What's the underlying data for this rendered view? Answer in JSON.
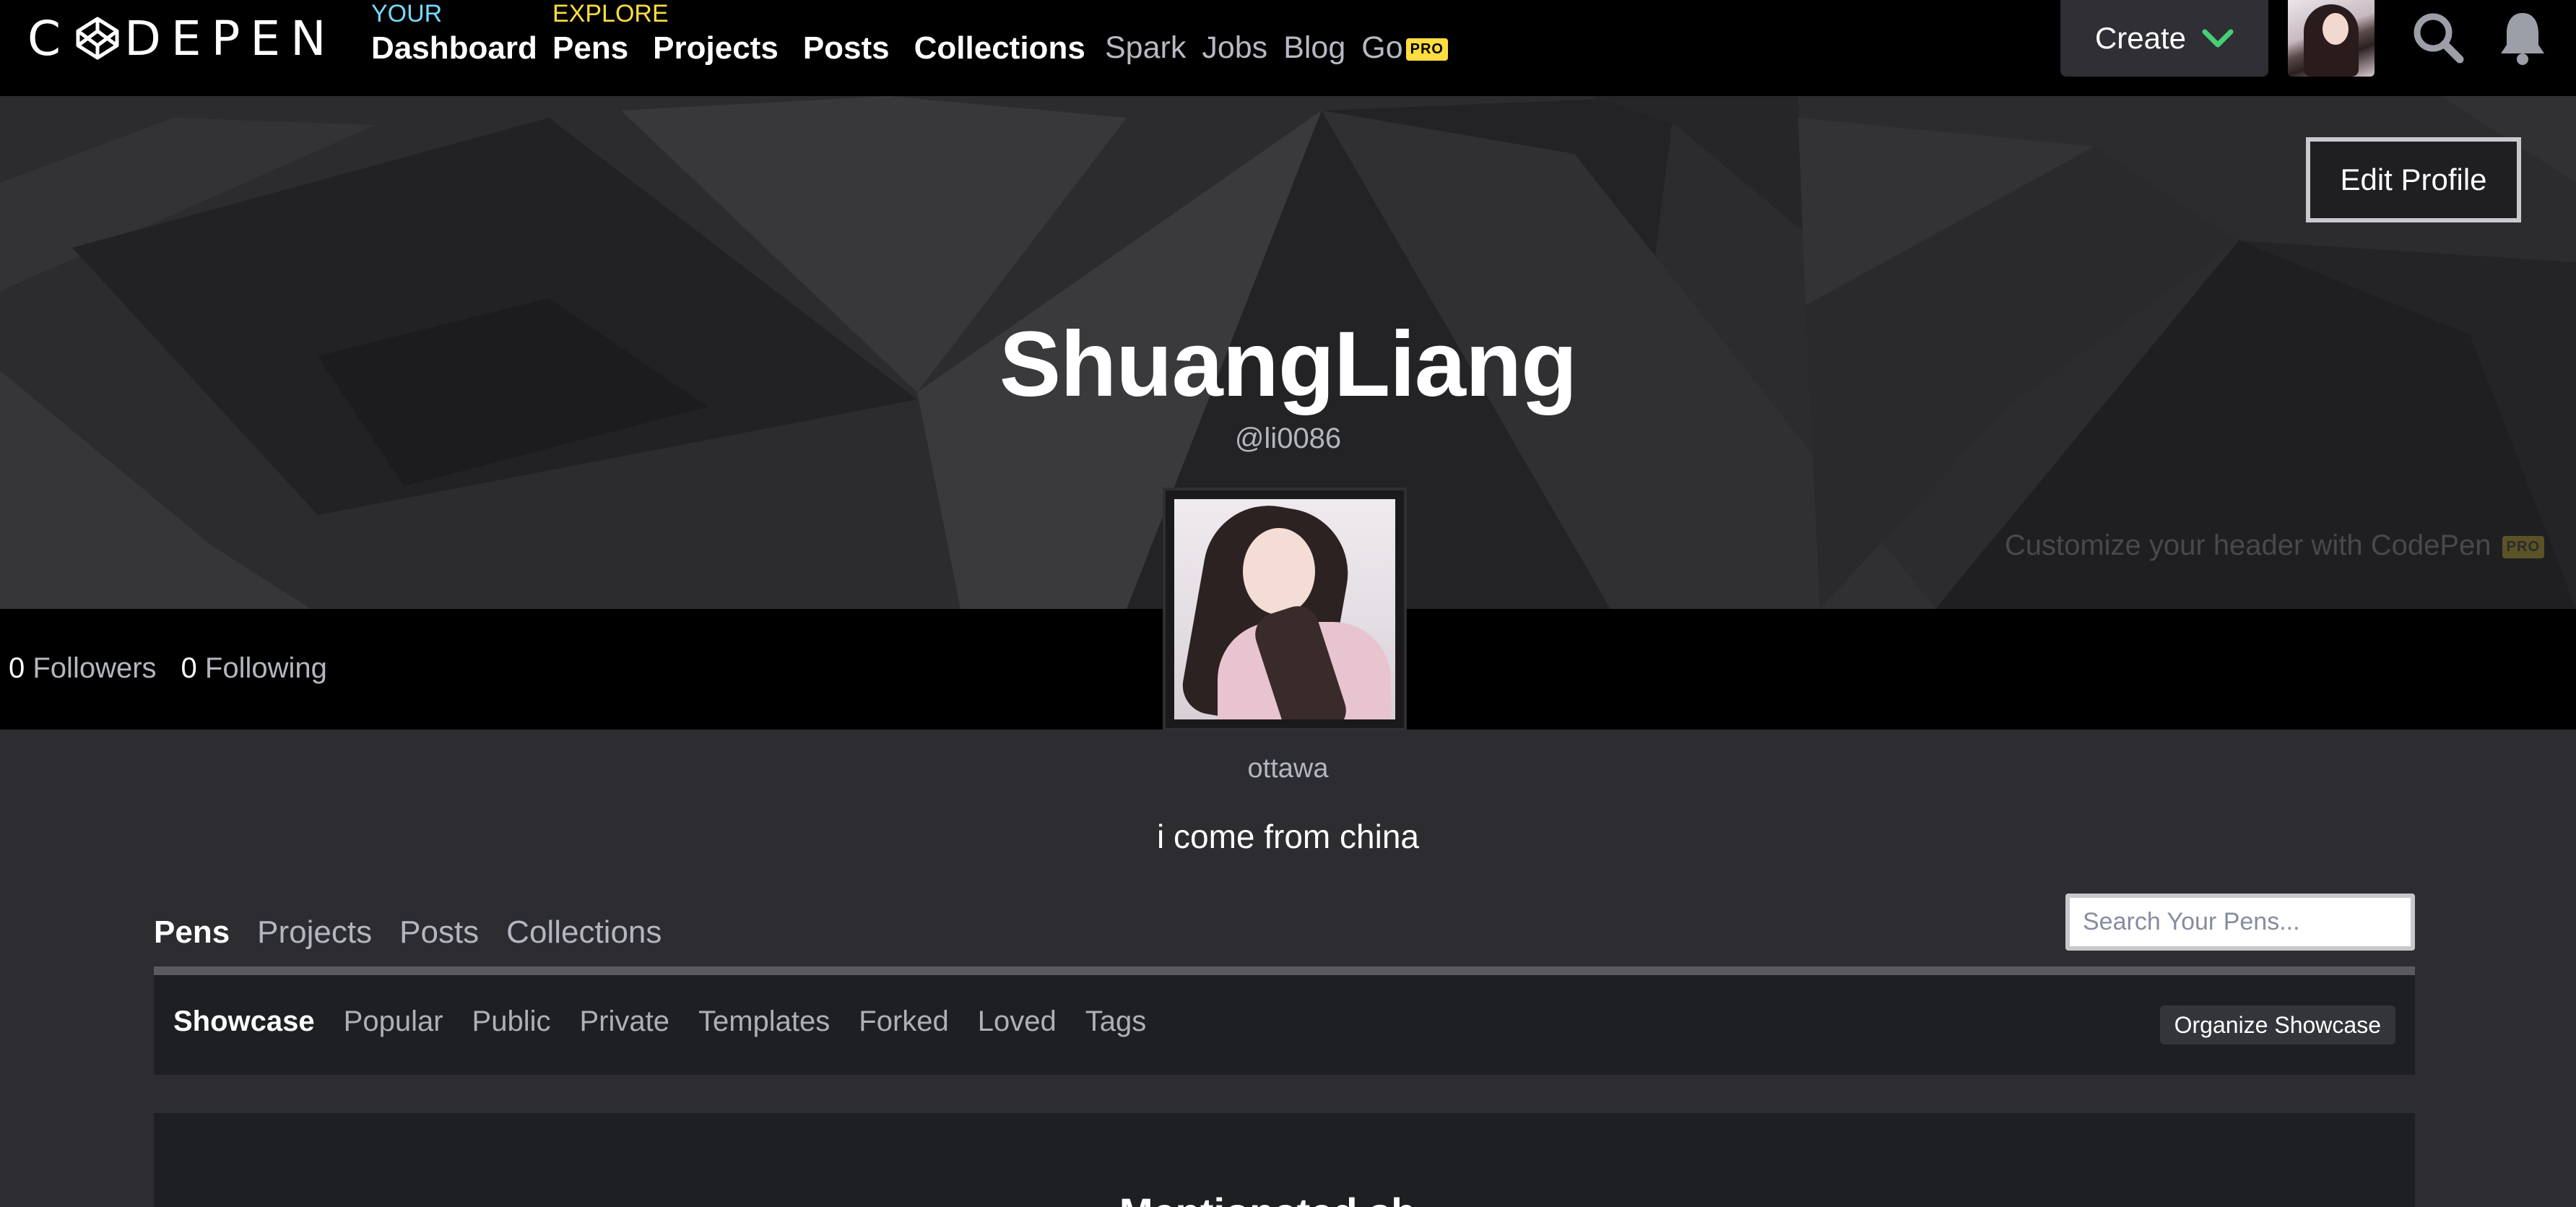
{
  "nav": {
    "logo": "C DEPEN",
    "your_kicker": "YOUR",
    "explore_kicker": "EXPLORE",
    "dashboard": "Dashboard",
    "pens": "Pens",
    "projects": "Projects",
    "posts": "Posts",
    "collections": "Collections",
    "spark": "Spark",
    "jobs": "Jobs",
    "blog": "Blog",
    "go": "Go",
    "pro_badge": "PRO",
    "create": "Create",
    "icons": [
      "codepen-logo-icon",
      "chevron-down-icon",
      "search-icon",
      "bell-icon"
    ]
  },
  "banner": {
    "edit_profile": "Edit Profile",
    "name": "ShuangLiang",
    "handle": "@li0086",
    "customize": "Customize your header with CodePen",
    "pro_badge": "PRO"
  },
  "stats": {
    "followers_count": "0",
    "followers_label": "Followers",
    "following_count": "0",
    "following_label": "Following"
  },
  "profile": {
    "location": "ottawa",
    "bio": "i come from china"
  },
  "tabs": {
    "items": [
      "Pens",
      "Projects",
      "Posts",
      "Collections"
    ],
    "active": "Pens",
    "search_placeholder": "Search Your Pens..."
  },
  "subnav": {
    "items": [
      "Showcase",
      "Popular",
      "Public",
      "Private",
      "Templates",
      "Forked",
      "Loved",
      "Tags"
    ],
    "active": "Showcase",
    "organize": "Organize Showcase"
  },
  "showcase": {
    "heading": "Mentionated sh..."
  },
  "colors": {
    "your_accent": "#76daff",
    "explore_accent": "#ffdd40",
    "pro_badge": "#ffdd40",
    "create_chevron": "#47cf73"
  }
}
